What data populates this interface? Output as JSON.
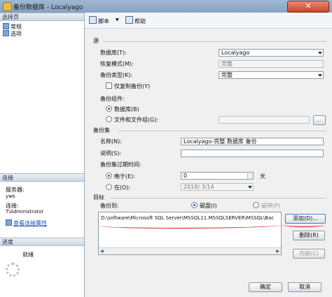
{
  "window": {
    "title": "备份数据库 - Localyago",
    "close_glyph": "✕"
  },
  "left": {
    "select_page": "选择页",
    "pages": [
      {
        "label": "常规"
      },
      {
        "label": "选项"
      }
    ],
    "connection": {
      "header": "连接",
      "server_label": "服务器:",
      "server_value": "ywk",
      "connect_label": "连接:",
      "connect_value": "T\\Administrator",
      "view_link": "查看连接属性"
    },
    "progress": {
      "header": "进度",
      "status": "就绪"
    }
  },
  "toolbar": {
    "script": "脚本",
    "script_dropdown": "▼",
    "help": "帮助"
  },
  "source": {
    "header": "源",
    "database_label": "数据库(T):",
    "database_value": "Localyago",
    "recovery_label": "恢复模式(M):",
    "recovery_value": "完整",
    "backup_type_label": "备份类型(K):",
    "backup_type_value": "完整",
    "copy_only": "仅复制备份(Y)",
    "component_label": "备份组件:",
    "component_database": "数据库(B)",
    "component_files": "文件和文件组(G):",
    "browse": "..."
  },
  "backup_set": {
    "header": "备份集",
    "name_label": "名称(N):",
    "name_value": "Localyago-完整 数据库 备份",
    "desc_label": "说明(S):",
    "desc_value": "",
    "expire_label": "备份集过期时间:",
    "after_label": "晚于(E):",
    "after_value": "0",
    "days_unit": "天",
    "on_label": "在(O):",
    "on_value": "2018/ 3/14"
  },
  "target": {
    "header": "目标",
    "backup_to": "备份到:",
    "disk": "磁盘(I)",
    "tape": "磁带(P)",
    "paths": [
      "D:\\software\\Microsoft SQL Server\\MSSQL11.MSSQLSERVER\\MSSQL\\Bac"
    ],
    "add": "添加(D)...",
    "remove": "删除(R)",
    "contents": "内容(C)"
  },
  "footer": {
    "ok": "确定",
    "cancel": "取消"
  }
}
